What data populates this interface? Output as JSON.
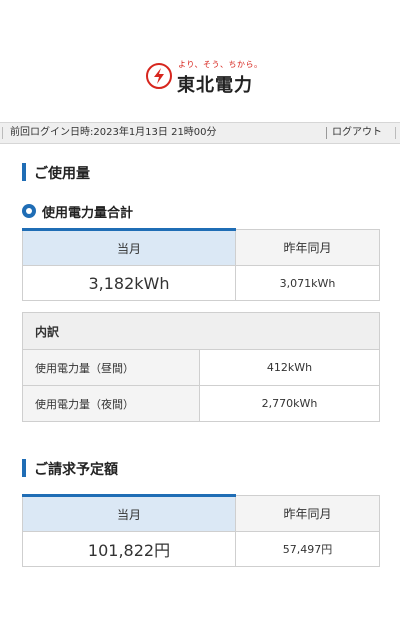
{
  "brand": {
    "tagline": "より、そう、ちから。",
    "name": "東北電力"
  },
  "login_bar": {
    "last_login": "前回ログイン日時:2023年1月13日 21時00分",
    "logout_label": "ログアウト"
  },
  "usage": {
    "section_title": "ご使用量",
    "total_title": "使用電力量合計",
    "headers": {
      "current": "当月",
      "last_year": "昨年同月"
    },
    "values": {
      "current": "3,182kWh",
      "last_year": "3,071kWh"
    },
    "breakdown": {
      "title": "内訳",
      "rows": [
        {
          "label": "使用電力量（昼間）",
          "value": "412kWh"
        },
        {
          "label": "使用電力量（夜間）",
          "value": "2,770kWh"
        }
      ]
    }
  },
  "billing": {
    "section_title": "ご請求予定額",
    "headers": {
      "current": "当月",
      "last_year": "昨年同月"
    },
    "values": {
      "current": "101,822円",
      "last_year": "57,497円"
    }
  },
  "colors": {
    "accent": "#1f6db5",
    "brand_red": "#d7261e"
  }
}
